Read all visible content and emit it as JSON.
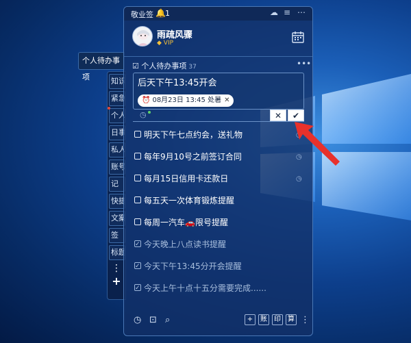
{
  "app": {
    "title": "敬业签",
    "notification_count": "1"
  },
  "sidebar": {
    "active_tab": "个人待办事项",
    "items": [
      "知识",
      "紧急",
      "个人",
      "日事",
      "私人",
      "账号",
      "记",
      "快捷",
      "文案",
      "签",
      "标题"
    ]
  },
  "profile": {
    "username": "雨疏风骤",
    "badge": "VIP"
  },
  "section": {
    "title": "个人待办事项",
    "count": "37"
  },
  "editor": {
    "text": "后天下午13:45开会",
    "reminder_chip": "08月23日 13:45 处暑"
  },
  "todos": [
    {
      "text": "明天下午七点约会，送礼物",
      "done": false,
      "has_reminder": true
    },
    {
      "text": "每年9月10号之前签订合同",
      "done": false,
      "has_reminder": true
    },
    {
      "text": "每月15日信用卡还款日",
      "done": false,
      "has_reminder": true
    },
    {
      "text": "每五天一次体育锻炼提醒",
      "done": false,
      "has_reminder": false
    },
    {
      "text": "每周一汽车🚗限号提醒",
      "done": false,
      "has_reminder": false
    },
    {
      "text": "今天晚上八点读书提醒",
      "done": true,
      "has_reminder": false
    },
    {
      "text": "今天下午13:45分开会提醒",
      "done": true,
      "has_reminder": false
    },
    {
      "text": "今天上午十点十五分需要完成......",
      "done": true,
      "has_reminder": false
    }
  ],
  "footer": {
    "buttons": [
      "账",
      "印",
      "算"
    ]
  },
  "colors": {
    "accent_red": "#e8312b",
    "panel_bg": "#123066",
    "vip_gold": "#f3c03a"
  }
}
